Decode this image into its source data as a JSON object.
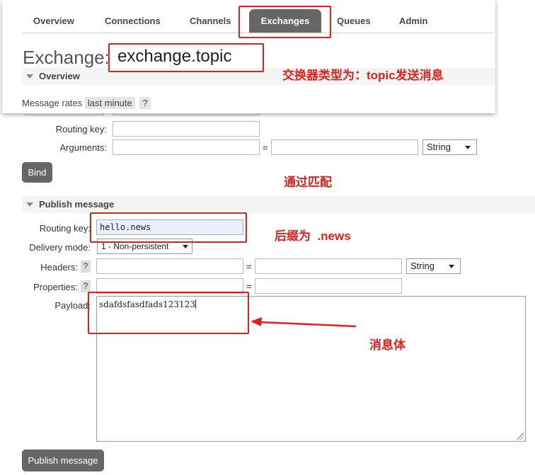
{
  "nav": {
    "tabs": [
      "Overview",
      "Connections",
      "Channels",
      "Exchanges",
      "Queues",
      "Admin"
    ],
    "active": "Exchanges"
  },
  "page": {
    "title_prefix": "Exchange:",
    "exchange_name": "exchange.topic"
  },
  "overview": {
    "section_label": "Overview"
  },
  "rates": {
    "label": "Message rates",
    "range": "last minute",
    "help": "?"
  },
  "bind_form": {
    "routing_key_label": "Routing key:",
    "arguments_label": "Arguments:",
    "equals": "=",
    "type_value": "String",
    "bind_button": "Bind"
  },
  "publish": {
    "section_label": "Publish message",
    "routing_key_label": "Routing key:",
    "routing_key_value": "hello.news",
    "delivery_mode_label": "Delivery mode:",
    "delivery_mode_value": "1 - Non-persistent",
    "headers_label": "Headers:",
    "properties_label": "Properties:",
    "help": "?",
    "equals": "=",
    "headers_type": "String",
    "payload_label": "Payload:",
    "payload_value": "sdafdsfasdfads123123",
    "publish_button": "Publish message"
  },
  "annotations": {
    "exchange_type_note": "交换器类型为：topic发送消息",
    "match_note": "通过匹配",
    "suffix_note": "后缀为  .news",
    "body_note": "消息体"
  },
  "colors": {
    "annotation": "#e0201a",
    "active_tab": "#666666",
    "button": "#666666"
  }
}
